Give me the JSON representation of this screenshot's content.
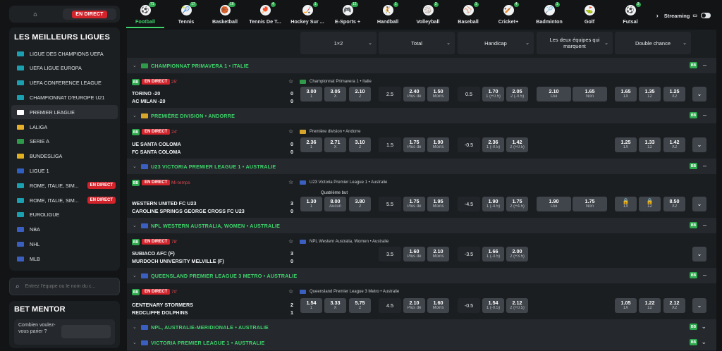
{
  "sidebar": {
    "live_label": "EN DIRECT",
    "leagues_title": "LES MEILLEURS LIGUES",
    "leagues": [
      {
        "label": "LIGUE DES CHAMPIONS UEFA",
        "flag": "#1aa0b0"
      },
      {
        "label": "UEFA LIGUE EUROPA",
        "flag": "#1aa0b0"
      },
      {
        "label": "UEFA CONFERENCE LEAGUE",
        "flag": "#1aa0b0"
      },
      {
        "label": "CHAMPIONNAT D'EUROPE U21",
        "flag": "#1aa0b0"
      },
      {
        "label": "PREMIER LEAGUE",
        "flag": "#ffffff",
        "selected": true
      },
      {
        "label": "LALIGA",
        "flag": "#e8b02a"
      },
      {
        "label": "SERIE A",
        "flag": "#2e9a4a"
      },
      {
        "label": "BUNDESLIGA",
        "flag": "#e0b020"
      },
      {
        "label": "LIGUE 1",
        "flag": "#2f5fc0"
      },
      {
        "label": "ROME, ITALIE, SIM...",
        "flag": "#1aa0b0",
        "live": "EN DIRECT"
      },
      {
        "label": "ROME, ITALIE, SIM...",
        "flag": "#1aa0b0",
        "live": "EN DIRECT"
      },
      {
        "label": "EUROLIGUE",
        "flag": "#1aa0b0"
      },
      {
        "label": "NBA",
        "flag": "#3a5fc0"
      },
      {
        "label": "NHL",
        "flag": "#3a5fc0"
      },
      {
        "label": "MLB",
        "flag": "#3a5fc0"
      }
    ],
    "search_placeholder": "Entrez l'équipe ou le nom du c...",
    "mentor_title": "BET MENTOR",
    "mentor_question": "Combien voulez-vous parier ?"
  },
  "sports": [
    {
      "label": "Football",
      "count": "71",
      "icon": "⚽",
      "active": true
    },
    {
      "label": "Tennis",
      "count": "17",
      "icon": "🎾"
    },
    {
      "label": "Basketball",
      "count": "16",
      "icon": "🏀"
    },
    {
      "label": "Tennis De T...",
      "count": "4",
      "icon": "🏓"
    },
    {
      "label": "Hockey Sur ...",
      "count": "1",
      "icon": "🏒"
    },
    {
      "label": "E-Sports +",
      "count": "12",
      "icon": "🎮"
    },
    {
      "label": "Handball",
      "count": "1",
      "icon": "🤾"
    },
    {
      "label": "Volleyball",
      "count": "2",
      "icon": "🏐"
    },
    {
      "label": "Baseball",
      "count": "1",
      "icon": "⚾"
    },
    {
      "label": "Cricket+",
      "count": "4",
      "icon": "🏏"
    },
    {
      "label": "Badminton",
      "count": "1",
      "icon": "🏸"
    },
    {
      "label": "Golf",
      "count": "",
      "icon": "⛳"
    },
    {
      "label": "Futsal",
      "count": "3",
      "icon": "⚽"
    }
  ],
  "streaming_label": "Streaming",
  "market_headers": [
    "1×2",
    "Total",
    "Handicap",
    "Les deux équipes qui marquent",
    "Double chance"
  ],
  "leagues": [
    {
      "title": "CHAMPIONNAT PRIMAVERA 1 • ITALIE",
      "flag": "#2e9a4a"
    },
    {
      "title": "PREMIÈRE DIVISION • ANDORRE",
      "flag": "#d6a52a"
    },
    {
      "title": "U23 VICTORIA PREMIER LEAGUE 1 • AUSTRALIE",
      "flag": "#3a5fc0"
    },
    {
      "title": "NPL WESTERN AUSTRALIA, WOMEN • AUSTRALIE",
      "flag": "#3a5fc0"
    },
    {
      "title": "QUEENSLAND PREMIER LEAGUE 3 METRO • AUSTRALIE",
      "flag": "#3a5fc0"
    },
    {
      "title": "NPL, AUSTRALIE-MERIDIONALE • AUSTRALIE",
      "flag": "#3a5fc0"
    },
    {
      "title": "VICTORIA PREMIER LEAGUE 1 • AUSTRALIE",
      "flag": "#3a5fc0"
    }
  ],
  "badge": "BB",
  "live": "EN DIRECT",
  "matches": [
    {
      "minute": "25'",
      "comp": "Championnat Primavera 1 • Italie",
      "flag": "#2e9a4a",
      "team1": "TORINO -20",
      "team2": "AC MILAN -20",
      "s1": "0",
      "s2": "0",
      "x12": [
        [
          "3.00",
          "1"
        ],
        [
          "3.05",
          "X"
        ],
        [
          "2.10",
          "2"
        ]
      ],
      "total_line": "2.5",
      "total": [
        [
          "2.40",
          "Plus de"
        ],
        [
          "1.50",
          "Moins"
        ]
      ],
      "hcp_line": "0.5",
      "hcp": [
        [
          "1.70",
          "1 (+0.5)"
        ],
        [
          "2.05",
          "2 (-0.5)"
        ]
      ],
      "btts": [
        [
          "2.10",
          "Oui"
        ],
        [
          "1.65",
          "Non"
        ]
      ],
      "dc": [
        [
          "1.65",
          "1X"
        ],
        [
          "1.35",
          "12"
        ],
        [
          "1.25",
          "X2"
        ]
      ]
    },
    {
      "minute": "24'",
      "comp": "Première division • Andorre",
      "flag": "#d6a52a",
      "team1": "UE SANTA COLOMA",
      "team2": "FC SANTA COLOMA",
      "s1": "0",
      "s2": "0",
      "x12": [
        [
          "2.36",
          "1"
        ],
        [
          "2.71",
          "X"
        ],
        [
          "3.10",
          "2"
        ]
      ],
      "total_line": "1.5",
      "total": [
        [
          "1.75",
          "Plus de"
        ],
        [
          "1.90",
          "Moins"
        ]
      ],
      "hcp_line": "-0.5",
      "hcp": [
        [
          "2.36",
          "1 (-0.5)"
        ],
        [
          "1.42",
          "2 (+0.5)"
        ]
      ],
      "dc": [
        [
          "1.25",
          "1X"
        ],
        [
          "1.33",
          "12"
        ],
        [
          "1.42",
          "X2"
        ]
      ]
    },
    {
      "minute": "Mi-temps",
      "comp": "U23 Victoria Premier League 1 • Australie",
      "flag": "#3a5fc0",
      "team1": "WESTERN UNITED FC U23",
      "team2": "CAROLINE SPRINGS GEORGE CROSS FC U23",
      "s1": "3",
      "s2": "0",
      "above": "Quatrième but",
      "x12": [
        [
          "1.30",
          "1"
        ],
        [
          "8.00",
          "Aucun"
        ],
        [
          "3.80",
          "2"
        ]
      ],
      "total_line": "5.5",
      "total": [
        [
          "1.75",
          "Plus de"
        ],
        [
          "1.95",
          "Moins"
        ]
      ],
      "hcp_line": "-4.5",
      "hcp": [
        [
          "1.90",
          "1 (-4.5)"
        ],
        [
          "1.75",
          "2 (+4.5)"
        ]
      ],
      "btts": [
        [
          "1.90",
          "Oui"
        ],
        [
          "1.75",
          "Non"
        ]
      ],
      "dc": [
        [
          "🔒",
          "1X"
        ],
        [
          "🔒",
          "12"
        ],
        [
          "8.50",
          "X2"
        ]
      ]
    },
    {
      "minute": "78'",
      "comp": "NPL Western Australia, Women • Australie",
      "flag": "#3a5fc0",
      "team1": "SUBIACO AFC (F)",
      "team2": "MURDOCH UNIVERSITY MELVILLE (F)",
      "s1": "3",
      "s2": "0",
      "total_line": "3.5",
      "total": [
        [
          "1.60",
          "Plus de"
        ],
        [
          "2.10",
          "Moins"
        ]
      ],
      "hcp_line": "-3.5",
      "hcp": [
        [
          "1.66",
          "1 (-3.5)"
        ],
        [
          "2.00",
          "2 (+3.5)"
        ]
      ]
    },
    {
      "minute": "70'",
      "comp": "Queensland Premier League 3 Metro • Australie",
      "flag": "#3a5fc0",
      "team1": "CENTENARY STORMERS",
      "team2": "REDCLIFFE DOLPHINS",
      "s1": "2",
      "s2": "1",
      "x12": [
        [
          "1.54",
          "1"
        ],
        [
          "3.33",
          "X"
        ],
        [
          "5.75",
          "2"
        ]
      ],
      "total_line": "4.5",
      "total": [
        [
          "2.10",
          "Plus de"
        ],
        [
          "1.60",
          "Moins"
        ]
      ],
      "hcp_line": "-0.5",
      "hcp": [
        [
          "1.54",
          "1 (-0.5)"
        ],
        [
          "2.12",
          "2 (+0.5)"
        ]
      ],
      "dc": [
        [
          "1.05",
          "1X"
        ],
        [
          "1.22",
          "12"
        ],
        [
          "2.12",
          "X2"
        ]
      ]
    }
  ]
}
